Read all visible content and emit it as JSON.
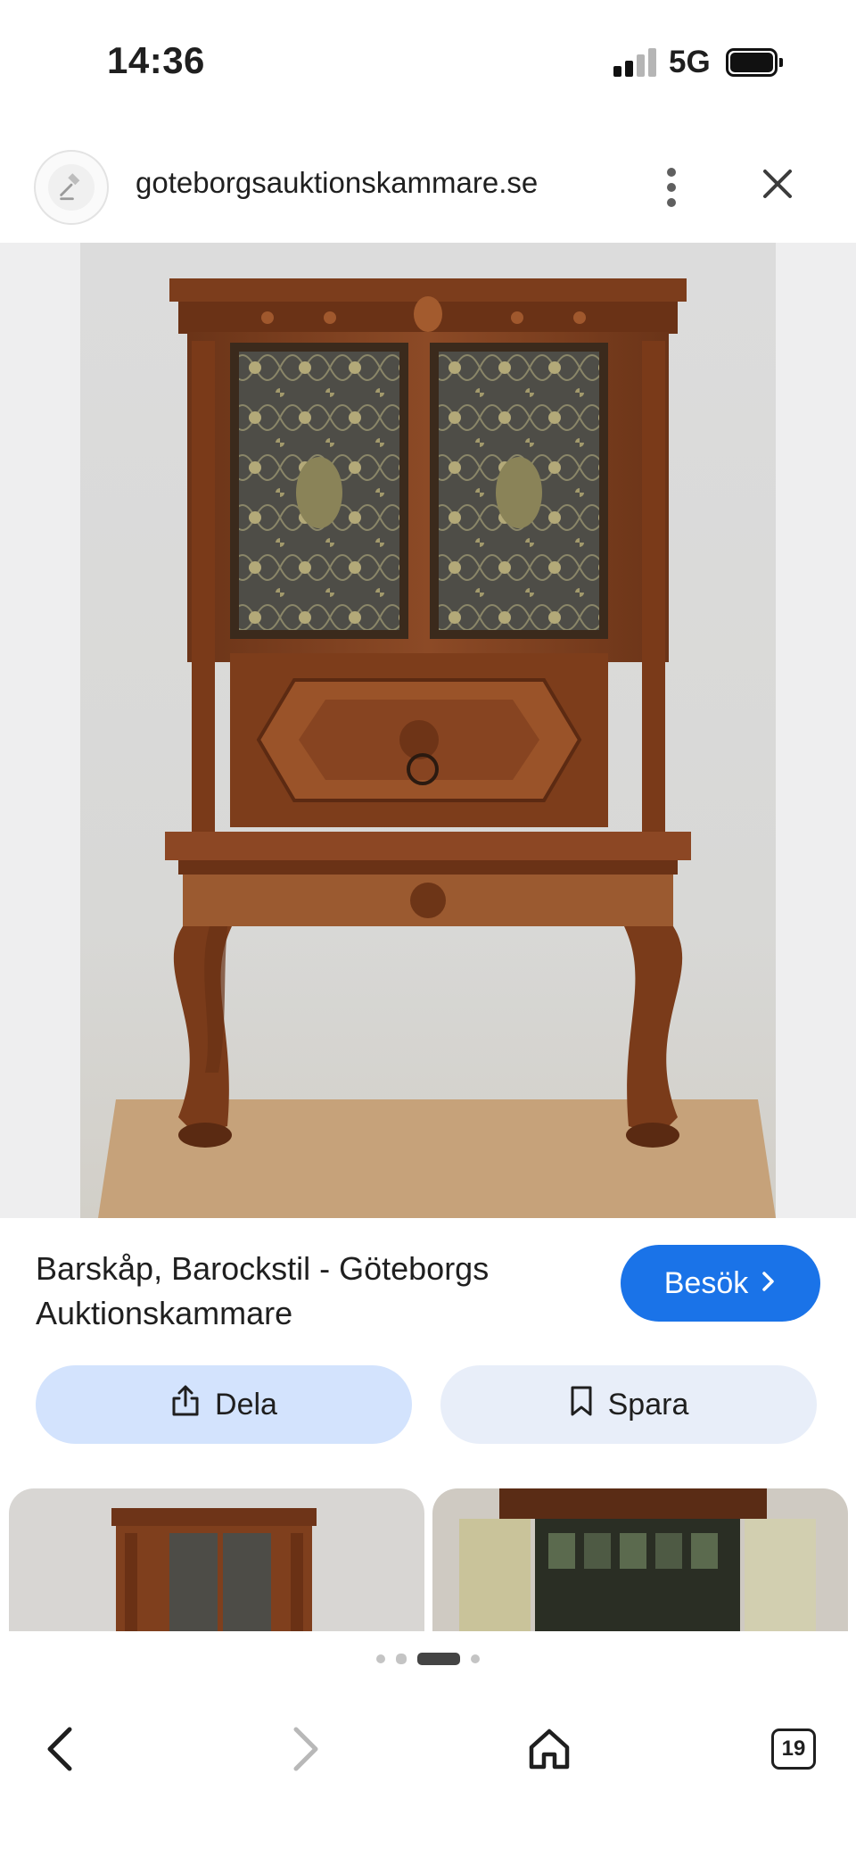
{
  "status_bar": {
    "time": "14:36",
    "network": "5G",
    "signal_bars_filled": 2,
    "signal_bars_total": 4
  },
  "url_bar": {
    "favicon_icon": "gavel-icon",
    "url": "goteborgsauktionskammare.se",
    "more_icon": "more-vert-icon",
    "close_icon": "close-icon"
  },
  "result": {
    "title": "Barskåp, Barockstil - Göteborgs Auktionskammare",
    "visit_label": "Besök",
    "visit_icon": "chevron-right-icon"
  },
  "actions": {
    "share_label": "Dela",
    "share_icon": "share-icon",
    "save_label": "Spara",
    "save_icon": "bookmark-icon"
  },
  "pagination": {
    "dots_total": 4,
    "active_dot": 3
  },
  "bottom_nav": {
    "back_icon": "chevron-left-icon",
    "forward_icon": "chevron-right-icon",
    "home_icon": "home-icon",
    "tabs_count": "19"
  },
  "colors": {
    "accent": "#1a73e8",
    "share_bg": "#d3e3fd",
    "save_bg": "#e8eef9",
    "wood": "#7a3f1f"
  }
}
